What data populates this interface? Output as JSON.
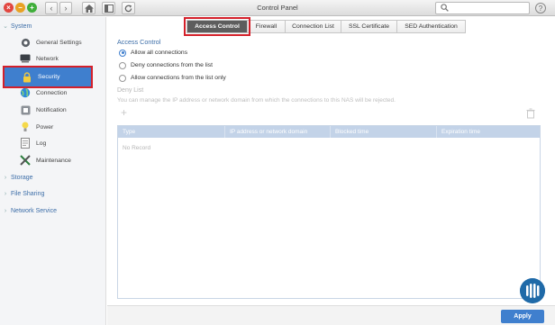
{
  "window": {
    "title": "Control Panel",
    "help_label": "?"
  },
  "sidebar": {
    "sections": [
      {
        "label": "System",
        "expanded": true
      },
      {
        "label": "Storage",
        "expanded": false
      },
      {
        "label": "File Sharing",
        "expanded": false
      },
      {
        "label": "Network Service",
        "expanded": false
      }
    ],
    "items": [
      {
        "label": "General Settings",
        "icon": "general-settings-icon"
      },
      {
        "label": "Network",
        "icon": "network-icon"
      },
      {
        "label": "Security",
        "icon": "lock-icon",
        "active": true
      },
      {
        "label": "Connection",
        "icon": "globe-icon"
      },
      {
        "label": "Notification",
        "icon": "notification-icon"
      },
      {
        "label": "Power",
        "icon": "power-icon"
      },
      {
        "label": "Log",
        "icon": "log-icon"
      },
      {
        "label": "Maintenance",
        "icon": "tools-icon"
      }
    ]
  },
  "tabs": [
    {
      "label": "Access Control",
      "active": true
    },
    {
      "label": "Firewall"
    },
    {
      "label": "Connection List"
    },
    {
      "label": "SSL Certificate"
    },
    {
      "label": "SED Authentication"
    }
  ],
  "access_control": {
    "title": "Access Control",
    "options": [
      {
        "label": "Allow all connections",
        "selected": true
      },
      {
        "label": "Deny connections from the list",
        "selected": false
      },
      {
        "label": "Allow connections from the list only",
        "selected": false
      }
    ]
  },
  "deny_list": {
    "title": "Deny List",
    "description": "You can manage the IP address or network domain from which the connections to this NAS will be rejected.",
    "columns": [
      "Type",
      "IP address or network domain",
      "Blocked time",
      "Expiration time"
    ],
    "empty_text": "No Record"
  },
  "footer": {
    "apply_label": "Apply"
  },
  "colors": {
    "accent": "#3f7fce",
    "highlight": "#d4202a",
    "section_text": "#3d6ea8"
  }
}
